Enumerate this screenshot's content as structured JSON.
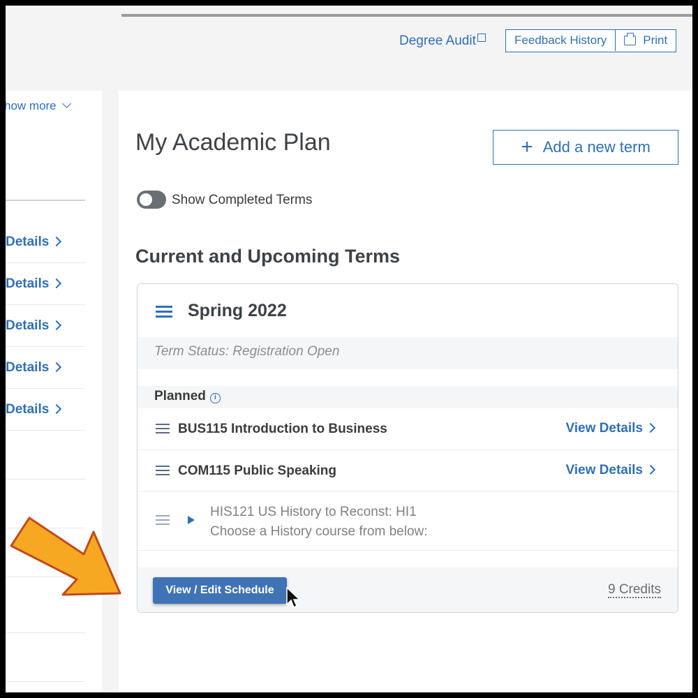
{
  "header": {
    "degree_audit": "Degree Audit",
    "feedback_history": "Feedback History",
    "print": "Print"
  },
  "left_panel": {
    "show_more": "how more",
    "detail_links": [
      "Details",
      "Details",
      "Details",
      "Details",
      "Details"
    ]
  },
  "main": {
    "title": "My Academic Plan",
    "add_term": "Add a new term",
    "toggle_label": "Show Completed Terms",
    "toggle_on": false,
    "section_title": "Current and Upcoming Terms"
  },
  "term": {
    "name": "Spring 2022",
    "status": "Term Status: Registration Open",
    "planned_label": "Planned",
    "courses": [
      {
        "name": "BUS115 Introduction to Business",
        "link": "View Details"
      },
      {
        "name": "COM115 Public Speaking",
        "link": "View Details"
      }
    ],
    "choice": {
      "line1": "HIS121 US History to Reconst: HI1",
      "line2": "Choose a History course from below:"
    },
    "edit_button": "View / Edit Schedule",
    "credits": "9 Credits"
  },
  "colors": {
    "accent": "#2f6fb6",
    "button": "#3f73b5",
    "annotation_arrow": "#f7a823"
  },
  "icons": [
    "external-link-icon",
    "print-icon",
    "chevron-down-icon",
    "chevron-right-icon",
    "plus-icon",
    "drag-handle-icon",
    "info-icon",
    "play-icon",
    "cursor-icon",
    "annotation-arrow-icon"
  ]
}
